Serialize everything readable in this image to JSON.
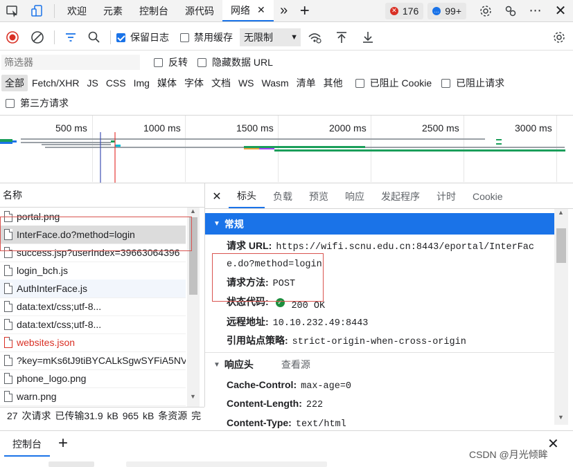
{
  "tabs": {
    "welcome": "欢迎",
    "elements": "元素",
    "console": "控制台",
    "sources": "源代码",
    "network": "网络",
    "errors_count": "176",
    "messages_count": "99+"
  },
  "toolbar": {
    "preserve_log": "保留日志",
    "disable_cache": "禁用缓存",
    "throttling": "无限制"
  },
  "filter": {
    "placeholder": "筛选器",
    "invert": "反转",
    "hide_data_urls": "隐藏数据 URL",
    "types": [
      "全部",
      "Fetch/XHR",
      "JS",
      "CSS",
      "Img",
      "媒体",
      "字体",
      "文档",
      "WS",
      "Wasm",
      "清单",
      "其他"
    ],
    "blocked_cookies": "已阻止 Cookie",
    "blocked_requests": "已阻止请求",
    "third_party": "第三方请求"
  },
  "timeline": {
    "ticks": [
      "500 ms",
      "1000 ms",
      "1500 ms",
      "2000 ms",
      "2500 ms",
      "3000 ms"
    ]
  },
  "request_list": {
    "header": "名称",
    "items": [
      {
        "name": "portal.png",
        "error": false
      },
      {
        "name": "InterFace.do?method=login",
        "error": false
      },
      {
        "name": "success.jsp?userIndex=39663064396",
        "error": false
      },
      {
        "name": "login_bch.js",
        "error": false
      },
      {
        "name": "AuthInterFace.js",
        "error": false
      },
      {
        "name": "data:text/css;utf-8...",
        "error": false
      },
      {
        "name": "data:text/css;utf-8...",
        "error": false
      },
      {
        "name": "websites.json",
        "error": true
      },
      {
        "name": "?key=mKs6tJ9tiBYCALkSgwSYFiA5NV",
        "error": false
      },
      {
        "name": "phone_logo.png",
        "error": false
      },
      {
        "name": "warn.png",
        "error": false
      }
    ]
  },
  "details": {
    "tabs": [
      "标头",
      "负载",
      "预览",
      "响应",
      "发起程序",
      "计时",
      "Cookie"
    ],
    "general_title": "常规",
    "request_url_key": "请求 URL:",
    "request_url_line1": "https://wifi.scnu.edu.cn:8443/eportal/InterFac",
    "request_url_line2": "e.do?method=login",
    "method_key": "请求方法:",
    "method_value": "POST",
    "status_key": "状态代码:",
    "status_value": "200 OK",
    "remote_key": "远程地址:",
    "remote_value": "10.10.232.49:8443",
    "referrer_key": "引用站点策略:",
    "referrer_value": "strict-origin-when-cross-origin",
    "response_headers_title": "响应头",
    "view_source": "查看源",
    "headers": [
      {
        "key": "Cache-Control:",
        "value": "max-age=0"
      },
      {
        "key": "Content-Length:",
        "value": "222"
      },
      {
        "key": "Content-Type:",
        "value": "text/html"
      }
    ]
  },
  "status_bar": {
    "text": "27 次请求  已传输31.9 kB  965 kB 条资源  完"
  },
  "drawer": {
    "console_tab": "控制台"
  },
  "watermark": "CSDN @月光倾眸",
  "colors": {
    "accent": "#1a73e8",
    "error_red": "#d93025",
    "highlight_box": "#d9534f",
    "selected_row": "#dcdcdc",
    "section_header": "#1a73e8"
  }
}
